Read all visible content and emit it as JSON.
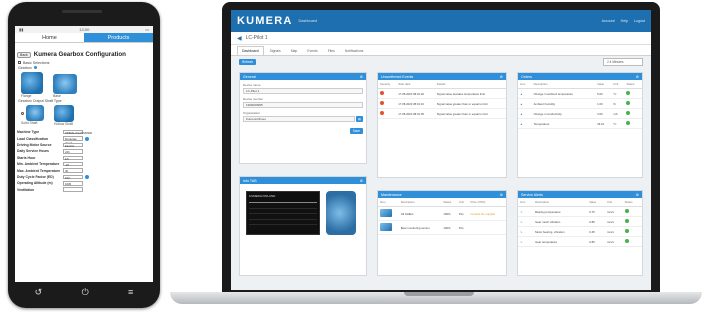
{
  "phone": {
    "status_time": "13:00",
    "tabs": {
      "home": "Home",
      "products": "Products"
    },
    "back_label": "Back",
    "title": "Kumera Gearbox Configuration",
    "basic_selections": "Basic Selections",
    "gearbox_label": "Gearbox",
    "gearbox_options": [
      "Flange",
      "Base"
    ],
    "output_shaft_label": "Gearbox Output Shaft Type",
    "shaft_options": [
      "Solid Shaft",
      "Hollow Shaft"
    ],
    "form": [
      {
        "label": "Machine Type",
        "value": "SPIRAL/CLASSIFIER"
      },
      {
        "label": "Load Classification",
        "value": "Moderate shock"
      },
      {
        "label": "Driving Motor Source",
        "value": "Electric Motor"
      },
      {
        "label": "Daily Service Hours",
        "value": "24h"
      },
      {
        "label": "Starts Hour",
        "value": "1/h"
      },
      {
        "label": "Min. Ambient Temperature",
        "value": "-20"
      },
      {
        "label": "Max. Ambient Temperature",
        "value": "40"
      },
      {
        "label": "Duty Cycle Factor (ED)",
        "value": "100"
      },
      {
        "label": "Operating Altitude (m)",
        "value": "1000"
      },
      {
        "label": "Ventilation",
        "value": ""
      }
    ]
  },
  "laptop": {
    "logo": "KUMERA",
    "header_link": "Dashboard",
    "header_links": [
      "Account",
      "Help",
      "Logout"
    ],
    "breadcrumb": "LC-Pilot 1",
    "tabs": [
      "Dashboard",
      "Signals",
      "Map",
      "Events",
      "Files",
      "Notifications"
    ],
    "sub_button": "Refresh",
    "time_select": "2.4 Minutes",
    "panels": {
      "general": {
        "title": "General",
        "fields": [
          {
            "label": "Device name",
            "value": "LC-Pilot 1"
          },
          {
            "label": "Device number",
            "value": "1909020965"
          },
          {
            "label": "Organization",
            "value": "Kumera Drives"
          }
        ],
        "save": "Save"
      },
      "events": {
        "title": "Unconfirmed Events",
        "columns": [
          "Severity",
          "Start date",
          "Details"
        ],
        "rows": [
          {
            "date": "17.08.2020 08:01:20",
            "details": "Signal value deviates temperature limit"
          },
          {
            "date": "17.08.2020 08:01:10",
            "details": "Signal value greater than or equal to limit"
          },
          {
            "date": "17.08.2020 08:01:05",
            "details": "Signal value greater than or equal to limit"
          }
        ]
      },
      "orders": {
        "title": "Orders",
        "columns": [
          "Icon",
          "Description",
          "Value",
          "Unit",
          "Status"
        ],
        "rows": [
          {
            "desc": "Change in ambient temperature",
            "value": "5.00",
            "unit": "°C"
          },
          {
            "desc": "Ambient humidity",
            "value": "1.00",
            "unit": "%"
          },
          {
            "desc": "Change in conductivity",
            "value": "3.00",
            "unit": "mS"
          },
          {
            "desc": "Temperature",
            "value": "36.01",
            "unit": "°C"
          }
        ]
      },
      "info": {
        "title": "Info TAB",
        "plate_text": "KUMERA FINLAND"
      },
      "parts": {
        "title": "Maintenance",
        "columns": [
          "Item",
          "Description",
          "Status",
          "Unit",
          "Price (NTD)"
        ],
        "rows": [
          {
            "desc": "Oil SHELL",
            "status": "100%",
            "unit": "Pcs",
            "price": "Contact the supplier"
          },
          {
            "desc": "Bear monitoring sensor",
            "status": "100%",
            "unit": "Pcs",
            "price": ""
          }
        ]
      },
      "notifications": {
        "title": "Service Alerts",
        "columns": [
          "Icon",
          "Description",
          "Value",
          "Unit",
          "Status"
        ],
        "rows": [
          {
            "desc": "Bearing temperature",
            "value": "0.70",
            "unit": "mm/s"
          },
          {
            "desc": "Gear mesh vibration",
            "value": "0.89",
            "unit": "mm/s"
          },
          {
            "desc": "Motor bearing, vibration",
            "value": "0.45",
            "unit": "mm/s"
          },
          {
            "desc": "Gear temperature",
            "value": "0.80",
            "unit": "mm/s"
          }
        ]
      }
    }
  }
}
